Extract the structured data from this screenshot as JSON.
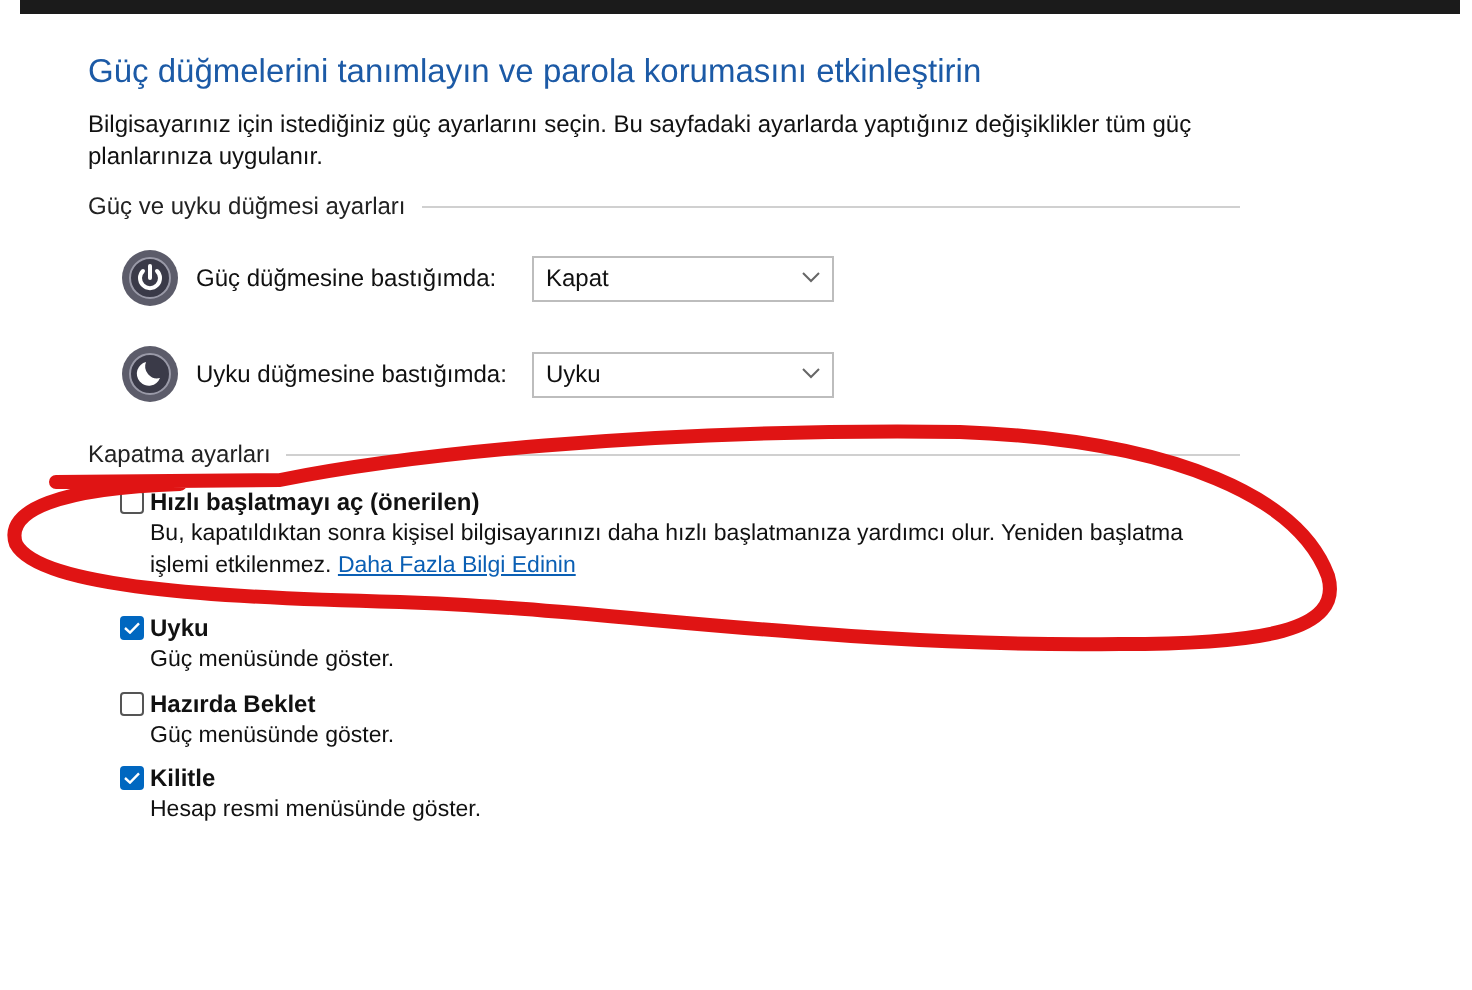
{
  "title": "Güç düğmelerini tanımlayın ve parola korumasını etkinleştirin",
  "description": "Bilgisayarınız için istediğiniz güç ayarlarını seçin. Bu sayfadaki ayarlarda yaptığınız değişiklikler tüm güç planlarınıza uygulanır.",
  "button_settings": {
    "heading": "Güç ve uyku düğmesi ayarları",
    "rows": [
      {
        "kind": "power",
        "label": "Güç düğmesine bastığımda:",
        "value": "Kapat"
      },
      {
        "kind": "sleep",
        "label": "Uyku düğmesine bastığımda:",
        "value": "Uyku"
      }
    ]
  },
  "shutdown_settings": {
    "heading": "Kapatma ayarları",
    "options": [
      {
        "label": "Hızlı başlatmayı aç (önerilen)",
        "checked": false,
        "description": "Bu, kapatıldıktan sonra kişisel bilgisayarınızı daha hızlı başlatmanıza yardımcı olur. Yeniden başlatma işlemi etkilenmez.",
        "link": "Daha Fazla Bilgi Edinin"
      },
      {
        "label": "Uyku",
        "checked": true,
        "description": "Güç menüsünde göster."
      },
      {
        "label": "Hazırda Beklet",
        "checked": false,
        "description": "Güç menüsünde göster."
      },
      {
        "label": "Kilitle",
        "checked": true,
        "description": "Hesap resmi menüsünde göster."
      }
    ]
  },
  "annotation": {
    "kind": "circle"
  }
}
